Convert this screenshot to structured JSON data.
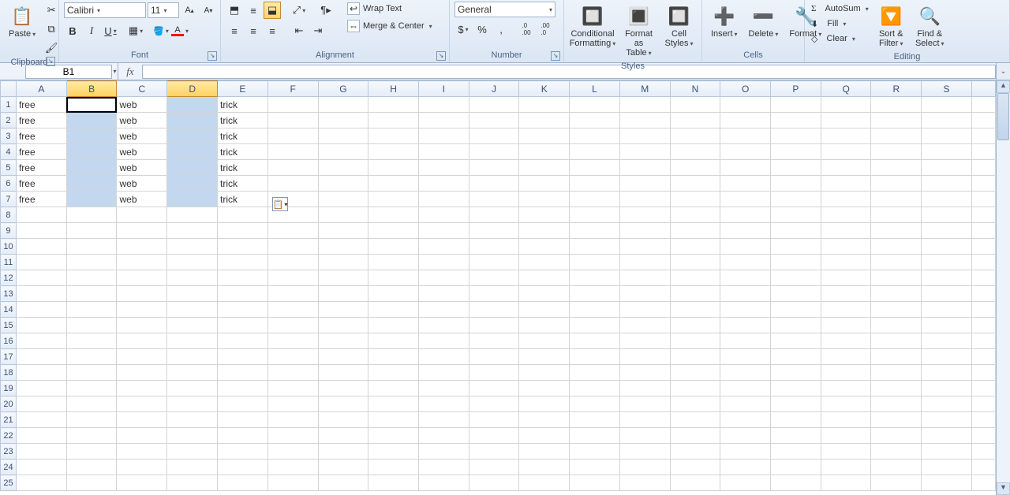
{
  "ribbon": {
    "clipboard": {
      "label": "Clipboard",
      "paste": "Paste",
      "cut_icon": "✂",
      "copy_icon": "⧉",
      "format_painter_icon": "🖌"
    },
    "font": {
      "label": "Font",
      "name": "Calibri",
      "size": "11",
      "grow_icon": "A▴",
      "shrink_icon": "A▾",
      "bold": "B",
      "italic": "I",
      "underline": "U",
      "border_icon": "▦",
      "fill_color": "#ffff00",
      "font_color": "#ff0000"
    },
    "alignment": {
      "label": "Alignment",
      "wrap": "Wrap Text",
      "merge": "Merge & Center"
    },
    "number": {
      "label": "Number",
      "format": "General",
      "currency": "$",
      "percent": "%",
      "comma": ",",
      "inc_dec": ".0→.00",
      "dec_dec": ".00→.0"
    },
    "styles": {
      "label": "Styles",
      "cond": "Conditional Formatting",
      "table": "Format as Table",
      "cell": "Cell Styles"
    },
    "cells": {
      "label": "Cells",
      "insert": "Insert",
      "delete": "Delete",
      "format": "Format"
    },
    "editing": {
      "label": "Editing",
      "autosum": "AutoSum",
      "fill": "Fill",
      "clear": "Clear",
      "sort": "Sort & Filter",
      "find": "Find & Select"
    }
  },
  "namebox": {
    "value": "B1"
  },
  "formula": {
    "value": ""
  },
  "fx": "fx",
  "columns": [
    "A",
    "B",
    "C",
    "D",
    "E",
    "F",
    "G",
    "H",
    "I",
    "J",
    "K",
    "L",
    "M",
    "N",
    "O",
    "P",
    "Q",
    "R",
    "S"
  ],
  "sel_cols": [
    "B",
    "D"
  ],
  "rows": 25,
  "active_cell": {
    "row": 1,
    "col": "B"
  },
  "sel_ranges": [
    {
      "col": "B",
      "r1": 1,
      "r2": 7
    },
    {
      "col": "D",
      "r1": 1,
      "r2": 7
    }
  ],
  "cells": {
    "A1": "free",
    "A2": "free",
    "A3": "free",
    "A4": "free",
    "A5": "free",
    "A6": "free",
    "A7": "free",
    "C1": "web",
    "C2": "web",
    "C3": "web",
    "C4": "web",
    "C5": "web",
    "C6": "web",
    "C7": "web",
    "E1": "trick",
    "E2": "trick",
    "E3": "trick",
    "E4": "trick",
    "E5": "trick",
    "E6": "trick",
    "E7": "trick"
  },
  "chart_data": {
    "type": "table",
    "columns": [
      "A",
      "B",
      "C",
      "D",
      "E"
    ],
    "rows": [
      [
        "free",
        "",
        "web",
        "",
        "trick"
      ],
      [
        "free",
        "",
        "web",
        "",
        "trick"
      ],
      [
        "free",
        "",
        "web",
        "",
        "trick"
      ],
      [
        "free",
        "",
        "web",
        "",
        "trick"
      ],
      [
        "free",
        "",
        "web",
        "",
        "trick"
      ],
      [
        "free",
        "",
        "web",
        "",
        "trick"
      ],
      [
        "free",
        "",
        "web",
        "",
        "trick"
      ]
    ]
  }
}
